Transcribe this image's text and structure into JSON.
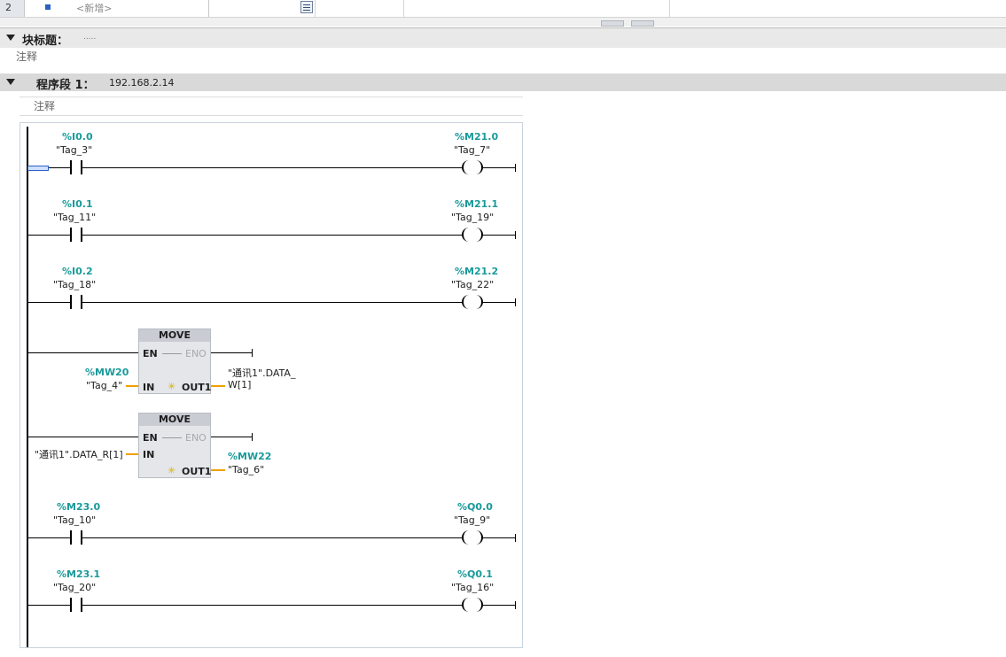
{
  "top_table": {
    "row_number": "2",
    "new_placeholder": "<新增>"
  },
  "block": {
    "title": "块标题：",
    "title_value": ".....",
    "comment": "注释"
  },
  "network": {
    "title": "程序段 1：",
    "ip": "192.168.2.14",
    "comment": "注释"
  },
  "rungs": [
    {
      "contact_addr": "%I0.0",
      "contact_tag": "\"Tag_3\"",
      "coil_addr": "%M21.0",
      "coil_tag": "\"Tag_7\""
    },
    {
      "contact_addr": "%I0.1",
      "contact_tag": "\"Tag_11\"",
      "coil_addr": "%M21.1",
      "coil_tag": "\"Tag_19\""
    },
    {
      "contact_addr": "%I0.2",
      "contact_tag": "\"Tag_18\"",
      "coil_addr": "%M21.2",
      "coil_tag": "\"Tag_22\""
    },
    {
      "contact_addr": "%M23.0",
      "contact_tag": "\"Tag_10\"",
      "coil_addr": "%Q0.0",
      "coil_tag": "\"Tag_9\""
    },
    {
      "contact_addr": "%M23.1",
      "contact_tag": "\"Tag_20\"",
      "coil_addr": "%Q0.1",
      "coil_tag": "\"Tag_16\""
    }
  ],
  "moves": [
    {
      "title": "MOVE",
      "en": "EN",
      "eno": "ENO",
      "in": "IN",
      "out": "OUT1",
      "in_addr": "%MW20",
      "in_tag": "\"Tag_4\"",
      "out_line1": "\"通讯1\".DATA_",
      "out_line2": "W[1]"
    },
    {
      "title": "MOVE",
      "en": "EN",
      "eno": "ENO",
      "in": "IN",
      "out": "OUT1",
      "in_tag": "\"通讯1\".DATA_R[1]",
      "out_addr": "%MW22",
      "out_tag": "\"Tag_6\""
    }
  ]
}
